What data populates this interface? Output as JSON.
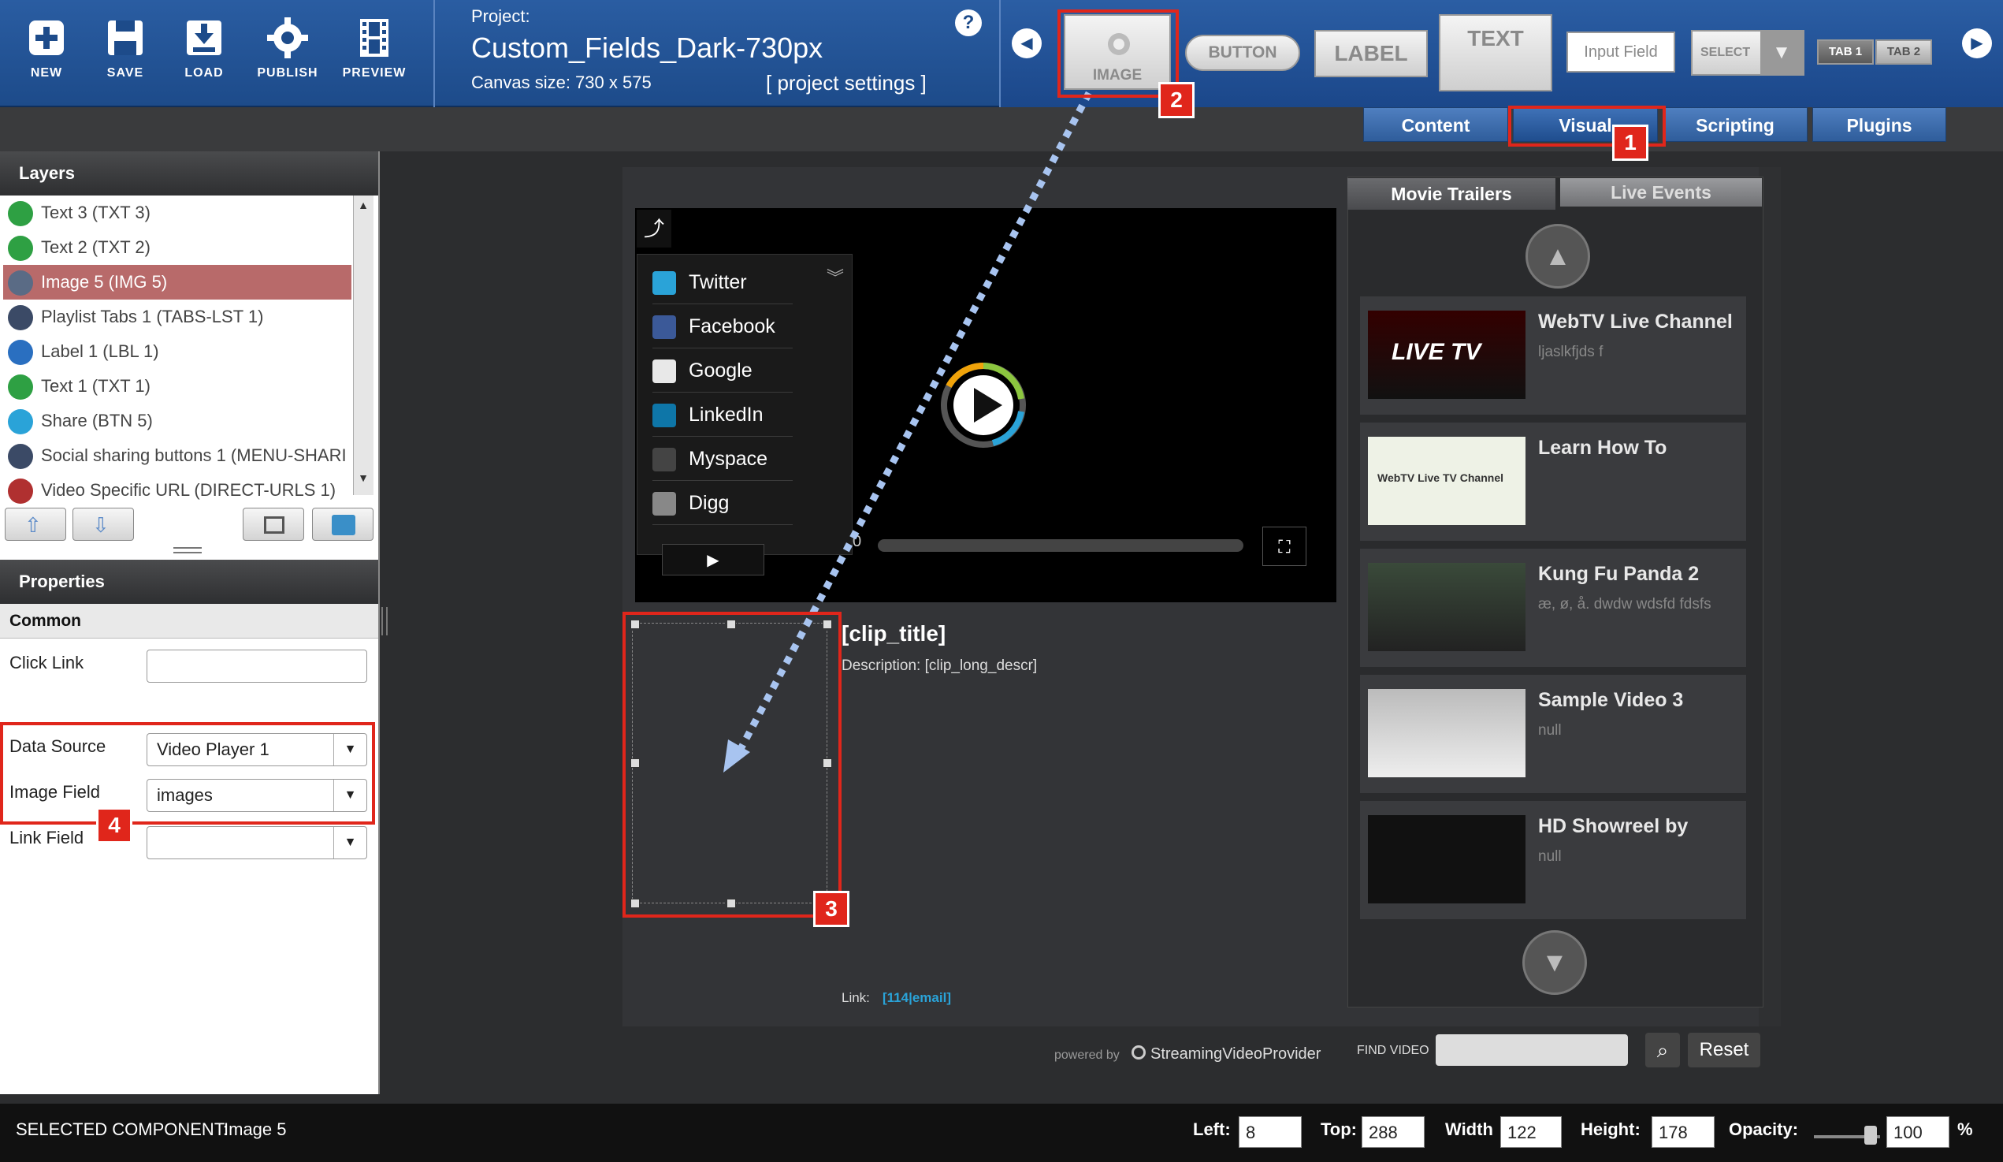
{
  "toolbar": {
    "new": "NEW",
    "save": "SAVE",
    "load": "LOAD",
    "publish": "PUBLISH",
    "preview": "PREVIEW"
  },
  "project": {
    "label": "Project:",
    "name": "Custom_Fields_Dark-730px",
    "canvas_size": "Canvas size:  730 x 575",
    "settings_link": "[ project settings ]",
    "help": "?"
  },
  "components": {
    "image": "IMAGE",
    "button": "BUTTON",
    "label": "LABEL",
    "text": "TEXT",
    "input_field": "Input Field",
    "select": "SELECT",
    "tab1": "TAB 1",
    "tab2": "TAB 2"
  },
  "view_tabs": [
    "Content",
    "Visual",
    "Scripting",
    "Plugins"
  ],
  "badges": [
    "1",
    "2",
    "3",
    "4"
  ],
  "layers": {
    "title": "Layers",
    "items": [
      {
        "label": "Text 3 (TXT 3)",
        "icon": "text-icon",
        "color": "#2ea043"
      },
      {
        "label": "Text 2 (TXT 2)",
        "icon": "text-icon",
        "color": "#2ea043"
      },
      {
        "label": "Image 5 (IMG 5)",
        "icon": "camera-icon",
        "color": "#5a6b85"
      },
      {
        "label": "Playlist Tabs 1 (TABS-LST 1)",
        "icon": "playlist-icon",
        "color": "#3b4a66"
      },
      {
        "label": "Label 1 (LBL 1)",
        "icon": "tag-icon",
        "color": "#2a6fc0"
      },
      {
        "label": "Text 1 (TXT 1)",
        "icon": "text-icon",
        "color": "#2ea043"
      },
      {
        "label": "Share (BTN 5)",
        "icon": "share-icon",
        "color": "#2aa3d8"
      },
      {
        "label": "Social sharing buttons 1 (MENU-SHARI",
        "icon": "grid-icon",
        "color": "#3b4a66"
      },
      {
        "label": "Video Specific URL (DIRECT-URLS 1)",
        "icon": "url-icon",
        "color": "#b03030"
      }
    ]
  },
  "properties": {
    "title": "Properties",
    "section": "Common",
    "click_link_label": "Click Link",
    "click_link_value": "",
    "data_source_label": "Data Source",
    "data_source_value": "Video Player 1",
    "image_field_label": "Image Field",
    "image_field_value": "images",
    "link_field_label": "Link Field",
    "link_field_value": ""
  },
  "player": {
    "share_items": [
      "Twitter",
      "Facebook",
      "Google",
      "LinkedIn",
      "Myspace",
      "Digg"
    ],
    "time": "0"
  },
  "clip": {
    "title": "[clip_title]",
    "description": "Description: [clip_long_descr]",
    "link_label": "Link:",
    "link_value": "[114|email]"
  },
  "playlist": {
    "tabs": [
      "Movie Trailers",
      "Live Events"
    ],
    "items": [
      {
        "title": "WebTV Live Channel",
        "desc": "ljaslkfjds f",
        "thumb": "LIVE TV"
      },
      {
        "title": "Learn How To",
        "desc": "",
        "thumb": "WebTV Live TV Channel"
      },
      {
        "title": "Kung Fu Panda 2",
        "desc": "æ, ø, å.  dwdw wdsfd  fdsfs",
        "thumb": ""
      },
      {
        "title": "Sample Video 3",
        "desc": "null",
        "thumb": ""
      },
      {
        "title": "HD Showreel by",
        "desc": "null",
        "thumb": ""
      }
    ]
  },
  "footer": {
    "powered_by": "powered by",
    "brand": "StreamingVideoProvider",
    "find_video": "FIND VIDEO",
    "find_value": "",
    "reset": "Reset"
  },
  "status": {
    "selected_label": "SELECTED COMPONENT:",
    "selected_value": "Image 5",
    "left_label": "Left:",
    "left": "8",
    "top_label": "Top:",
    "top": "288",
    "width_label": "Width",
    "width": "122",
    "height_label": "Height:",
    "height": "178",
    "opacity_label": "Opacity:",
    "opacity": "100",
    "percent": "%"
  }
}
